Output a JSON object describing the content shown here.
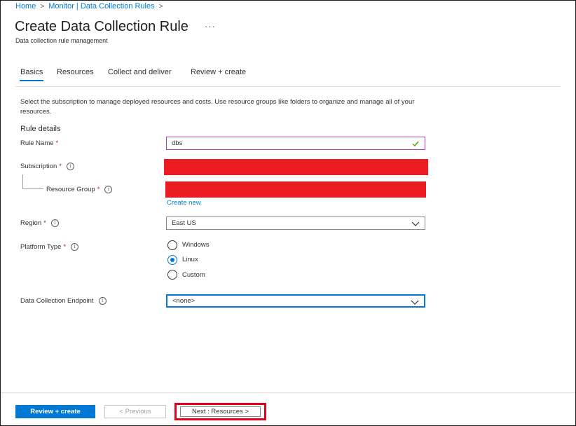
{
  "breadcrumb": {
    "home": "Home",
    "sep1": ">",
    "monitor": "Monitor | Data Collection Rules",
    "sep2": ">"
  },
  "header": {
    "title": "Create Data Collection Rule",
    "more": "···",
    "subtitle": "Data collection rule management"
  },
  "tabs": [
    {
      "label": "Basics"
    },
    {
      "label": "Resources"
    },
    {
      "label": "Collect and deliver"
    },
    {
      "label": "Review + create"
    }
  ],
  "description": "Select the subscription to manage deployed resources and costs. Use resource groups like folders to organize and manage all of your resources.",
  "section_title": "Rule details",
  "fields": {
    "rule_name": {
      "label": "Rule Name",
      "required": "*",
      "value": "dbs"
    },
    "subscription": {
      "label": "Subscription",
      "required": "*"
    },
    "resource_group": {
      "label": "Resource Group",
      "required": "*",
      "create_new": "Create new"
    },
    "region": {
      "label": "Region",
      "required": "*",
      "value": "East US"
    },
    "platform_type": {
      "label": "Platform Type",
      "required": "*",
      "options": [
        "Windows",
        "Linux",
        "Custom"
      ],
      "selected": "Linux"
    },
    "endpoint": {
      "label": "Data Collection Endpoint",
      "value": "<none>"
    }
  },
  "footer": {
    "review_create": "Review + create",
    "previous": "< Previous",
    "next": "Next : Resources >"
  },
  "colors": {
    "accent": "#0078d4",
    "redaction": "#ec1c24",
    "highlight": "#e3001b",
    "valid": "#57a300",
    "rule_name_border": "#c239b3"
  }
}
